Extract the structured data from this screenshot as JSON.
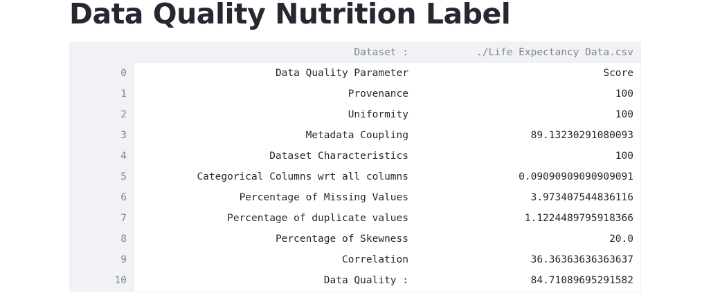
{
  "page": {
    "title": "Data Quality Nutrition Label"
  },
  "table": {
    "header": {
      "index": "",
      "column_0": "Dataset :",
      "column_1": "./Life Expectancy Data.csv"
    },
    "rows": [
      {
        "index": "0",
        "parameter": "Data Quality Parameter",
        "score": "Score"
      },
      {
        "index": "1",
        "parameter": "Provenance",
        "score": "100"
      },
      {
        "index": "2",
        "parameter": "Uniformity",
        "score": "100"
      },
      {
        "index": "3",
        "parameter": "Metadata Coupling",
        "score": "89.13230291080093"
      },
      {
        "index": "4",
        "parameter": "Dataset Characteristics",
        "score": "100"
      },
      {
        "index": "5",
        "parameter": "Categorical Columns wrt all columns",
        "score": "0.09090909090909091"
      },
      {
        "index": "6",
        "parameter": "Percentage of Missing Values",
        "score": "3.973407544836116"
      },
      {
        "index": "7",
        "parameter": "Percentage of duplicate values",
        "score": "1.1224489795918366"
      },
      {
        "index": "8",
        "parameter": "Percentage of Skewness",
        "score": "20.0"
      },
      {
        "index": "9",
        "parameter": "Correlation",
        "score": "36.36363636363637"
      },
      {
        "index": "10",
        "parameter": "Data Quality :",
        "score": "84.71089695291582"
      }
    ]
  },
  "colors": {
    "text": "#262730",
    "header_background": "#f0f2f6",
    "header_text": "#808495",
    "border": "#eef0f4"
  }
}
